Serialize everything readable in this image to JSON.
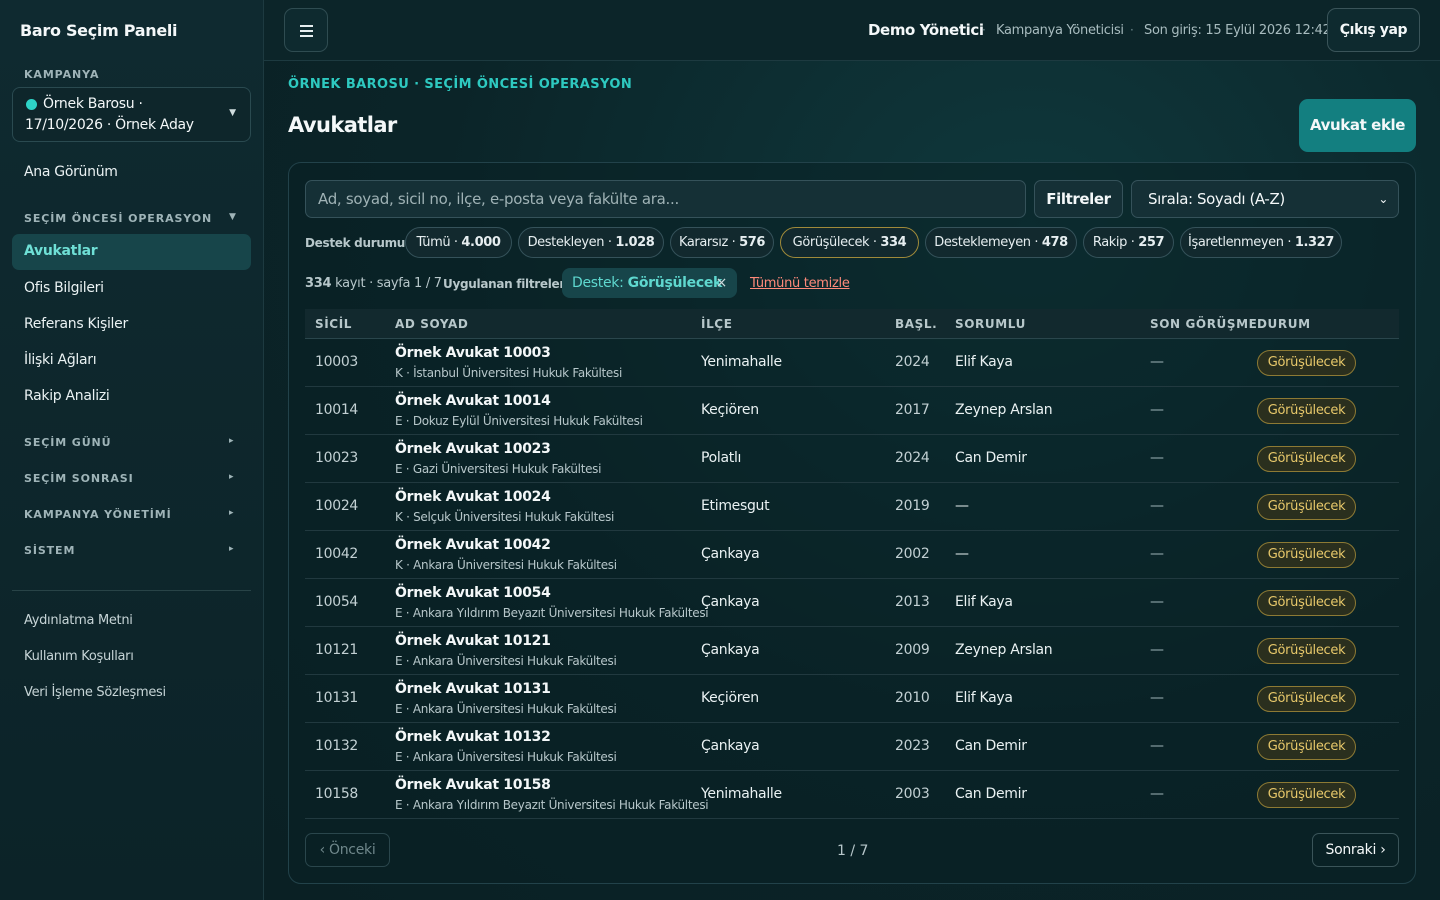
{
  "sidebar": {
    "brand": "Baro Seçim Paneli",
    "campaign_label": "KAMPANYA",
    "campaign_line1": "Örnek Barosu ·",
    "campaign_line2": "17/10/2026 · Örnek Aday",
    "home": "Ana Görünüm",
    "pre_election_label": "SEÇİM ÖNCESİ OPERASYON",
    "pre_items": [
      "Avukatlar",
      "Ofis Bilgileri",
      "Referans Kişiler",
      "İlişki Ağları",
      "Rakip Analizi"
    ],
    "sections": [
      "SEÇİM GÜNÜ",
      "SEÇİM SONRASI",
      "KAMPANYA YÖNETİMİ",
      "SİSTEM"
    ],
    "footer_links": [
      "Aydınlatma Metni",
      "Kullanım Koşulları",
      "Veri İşleme Sözleşmesi"
    ]
  },
  "topbar": {
    "user": "Demo Yönetici",
    "separator": "·",
    "role": "Kampanya Yöneticisi",
    "last_login": "Son giriş: 15 Eylül 2026 12:42",
    "logout": "Çıkış yap"
  },
  "main": {
    "breadcrumb": "ÖRNEK BAROSU · SEÇİM ÖNCESİ OPERASYON",
    "title": "Avukatlar",
    "add_button": "Avukat ekle",
    "search_placeholder": "Ad, soyad, sicil no, ilçe, e-posta veya fakülte ara...",
    "filters_button": "Filtreler",
    "sort_label": "Sırala: Soyadı (A-Z)",
    "status_label": "Destek durumu:",
    "status_chips": [
      {
        "label": "Tümü",
        "count": "4.000"
      },
      {
        "label": "Destekleyen",
        "count": "1.028"
      },
      {
        "label": "Kararsız",
        "count": "576"
      },
      {
        "label": "Görüşülecek",
        "count": "334"
      },
      {
        "label": "Desteklemeyen",
        "count": "478"
      },
      {
        "label": "Rakip",
        "count": "257"
      },
      {
        "label": "İşaretlenmeyen",
        "count": "1.327"
      }
    ],
    "count_bold": "334",
    "count_rest": " kayıt · sayfa 1 / 7",
    "applied_label": "Uygulanan filtreler:",
    "applied_key": "Destek:",
    "applied_value": "Görüşülecek",
    "clear_all": "Tümünü temizle",
    "columns": [
      "SİCİL",
      "AD SOYAD",
      "İLÇE",
      "BAŞL.",
      "SORUMLU",
      "SON GÖRÜŞME",
      "DURUM"
    ],
    "rows": [
      {
        "sicil": "10003",
        "name": "Örnek Avukat 10003",
        "sub": "K · İstanbul Üniversitesi Hukuk Fakültesi",
        "ilce": "Yenimahalle",
        "basl": "2024",
        "sorumlu": "Elif Kaya",
        "son": "—",
        "durum": "Görüşülecek"
      },
      {
        "sicil": "10014",
        "name": "Örnek Avukat 10014",
        "sub": "E · Dokuz Eylül Üniversitesi Hukuk Fakültesi",
        "ilce": "Keçiören",
        "basl": "2017",
        "sorumlu": "Zeynep Arslan",
        "son": "—",
        "durum": "Görüşülecek"
      },
      {
        "sicil": "10023",
        "name": "Örnek Avukat 10023",
        "sub": "E · Gazi Üniversitesi Hukuk Fakültesi",
        "ilce": "Polatlı",
        "basl": "2024",
        "sorumlu": "Can Demir",
        "son": "—",
        "durum": "Görüşülecek"
      },
      {
        "sicil": "10024",
        "name": "Örnek Avukat 10024",
        "sub": "K · Selçuk Üniversitesi Hukuk Fakültesi",
        "ilce": "Etimesgut",
        "basl": "2019",
        "sorumlu": "—",
        "son": "—",
        "durum": "Görüşülecek"
      },
      {
        "sicil": "10042",
        "name": "Örnek Avukat 10042",
        "sub": "K · Ankara Üniversitesi Hukuk Fakültesi",
        "ilce": "Çankaya",
        "basl": "2002",
        "sorumlu": "—",
        "son": "—",
        "durum": "Görüşülecek"
      },
      {
        "sicil": "10054",
        "name": "Örnek Avukat 10054",
        "sub": "E · Ankara Yıldırım Beyazıt Üniversitesi Hukuk Fakültesi",
        "ilce": "Çankaya",
        "basl": "2013",
        "sorumlu": "Elif Kaya",
        "son": "—",
        "durum": "Görüşülecek"
      },
      {
        "sicil": "10121",
        "name": "Örnek Avukat 10121",
        "sub": "E · Ankara Üniversitesi Hukuk Fakültesi",
        "ilce": "Çankaya",
        "basl": "2009",
        "sorumlu": "Zeynep Arslan",
        "son": "—",
        "durum": "Görüşülecek"
      },
      {
        "sicil": "10131",
        "name": "Örnek Avukat 10131",
        "sub": "E · Ankara Üniversitesi Hukuk Fakültesi",
        "ilce": "Keçiören",
        "basl": "2010",
        "sorumlu": "Elif Kaya",
        "son": "—",
        "durum": "Görüşülecek"
      },
      {
        "sicil": "10132",
        "name": "Örnek Avukat 10132",
        "sub": "E · Ankara Üniversitesi Hukuk Fakültesi",
        "ilce": "Çankaya",
        "basl": "2023",
        "sorumlu": "Can Demir",
        "son": "—",
        "durum": "Görüşülecek"
      },
      {
        "sicil": "10158",
        "name": "Örnek Avukat 10158",
        "sub": "E · Ankara Yıldırım Beyazıt Üniversitesi Hukuk Fakültesi",
        "ilce": "Yenimahalle",
        "basl": "2003",
        "sorumlu": "Can Demir",
        "son": "—",
        "durum": "Görüşülecek"
      }
    ],
    "prev": "‹ Önceki",
    "page": "1 / 7",
    "next": "Sonraki ›"
  },
  "colors": {
    "accent": "#2ec9c0",
    "primary_button": "#137f80",
    "status_pending": "#e7c86a",
    "danger_link": "#ff8a7a"
  }
}
